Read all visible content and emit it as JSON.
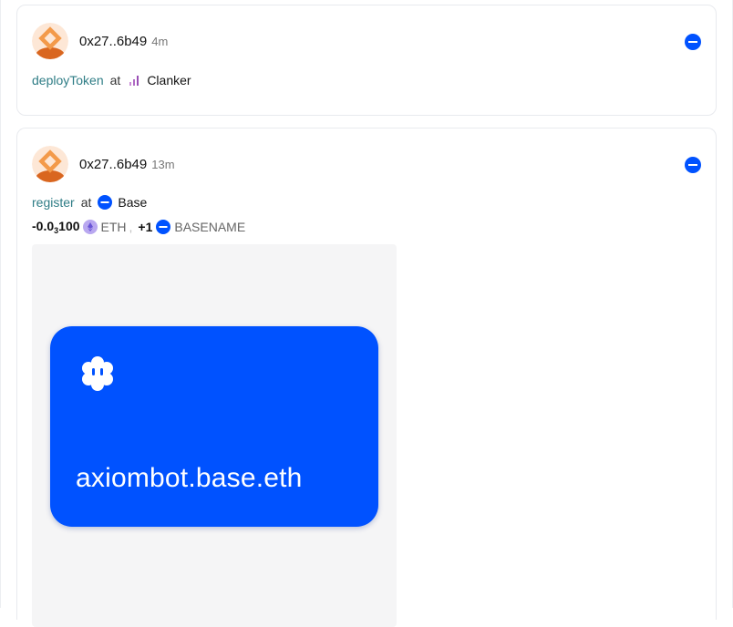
{
  "activities": [
    {
      "address": "0x27..6b49",
      "time": "4m",
      "method": "deployToken",
      "at": "at",
      "app": "Clanker",
      "app_icon": "bar-chart-icon",
      "chain_icon": "base-chain-icon"
    },
    {
      "address": "0x27..6b49",
      "time": "13m",
      "method": "register",
      "at": "at",
      "app": "Base",
      "app_icon": "base-chain-icon",
      "chain_icon": "base-chain-icon",
      "transfers": {
        "out_sign": "-",
        "out_amount_prefix": "0.0",
        "out_amount_sub": "3",
        "out_amount_suffix": "100",
        "out_token": "ETH",
        "separator": ",",
        "in_amount": "+1",
        "in_token": "BASENAME"
      },
      "nft": {
        "name": "axiombot.base.eth",
        "background": "#0052ff"
      }
    }
  ],
  "colors": {
    "accent_method": "#2f7d86",
    "base_blue": "#0052ff",
    "avatar_orange": "#f08a3a"
  }
}
